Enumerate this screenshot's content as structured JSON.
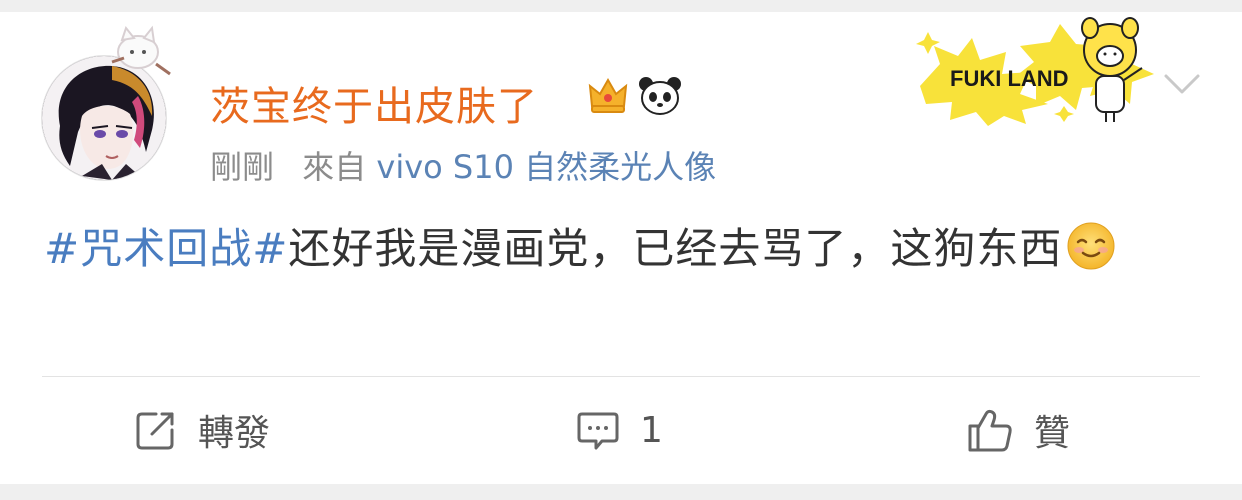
{
  "post": {
    "username": "茨宝终于出皮肤了",
    "time": "剛剛",
    "source_prefix": "來自",
    "source_device": "vivo S10 自然柔光人像",
    "badge_text": "FUKI LAND",
    "text": {
      "hashtag": "#咒术回战#",
      "body": "还好我是漫画党，已经去骂了，这狗东西"
    }
  },
  "actions": {
    "repost_label": "轉發",
    "comment_count": "1",
    "like_label": "贊"
  },
  "icons": {
    "avatar": "avatar",
    "crown": "crown-icon",
    "panda": "panda-icon",
    "chevron": "chevron-down-icon",
    "smile": "smile-icon",
    "repost": "repost-icon",
    "comment": "comment-icon",
    "like": "thumbs-up-icon"
  },
  "colors": {
    "username": "#e86a1e",
    "hashtag": "#4a7dc0",
    "device": "#5b83b5",
    "meta": "#8c8c8c",
    "body": "#333333"
  }
}
